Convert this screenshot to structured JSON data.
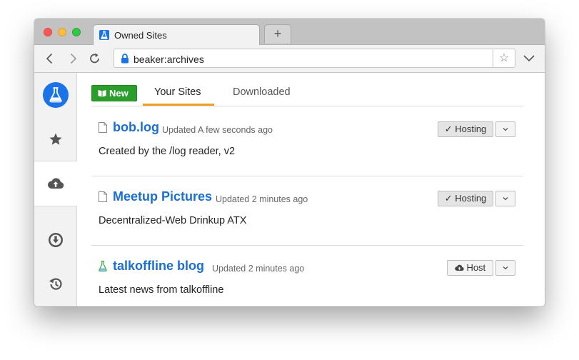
{
  "browser": {
    "tab_title": "Owned Sites",
    "new_tab_symbol": "+",
    "url": "beaker:archives",
    "back_icon": "chevron-left-icon",
    "forward_icon": "chevron-right-icon",
    "reload_icon": "reload-icon",
    "bookmark_icon": "star-outline-icon"
  },
  "sidebar": {
    "items": [
      {
        "name": "logo",
        "icon": "flask-icon"
      },
      {
        "name": "bookmarks",
        "icon": "star-icon"
      },
      {
        "name": "archives",
        "icon": "cloud-upload-icon",
        "active": true
      },
      {
        "name": "downloads",
        "icon": "download-circle-icon"
      },
      {
        "name": "history",
        "icon": "history-icon"
      }
    ]
  },
  "main": {
    "new_button_label": "New",
    "tabs": [
      {
        "label": "Your Sites",
        "active": true
      },
      {
        "label": "Downloaded",
        "active": false
      }
    ],
    "sites": [
      {
        "title": "bob.log",
        "updated": "Updated A few seconds ago",
        "description": "Created by the /log reader, v2",
        "icon": "file-icon",
        "action_label": "✓ Hosting"
      },
      {
        "title": "Meetup Pictures",
        "updated": "Updated 2 minutes ago",
        "description": "Decentralized-Web Drinkup ATX",
        "icon": "file-icon",
        "action_label": "✓ Hosting"
      },
      {
        "title": "talkoffline blog",
        "updated": "Updated 2 minutes ago",
        "description": "Latest news from talkoffline",
        "icon": "flask-icon",
        "action_label": "Host"
      }
    ]
  },
  "colors": {
    "accent_blue": "#1a73e8",
    "link_blue": "#1a6fd1",
    "new_button_green": "#2a9d2a",
    "tab_underline_orange": "#f0a020"
  }
}
